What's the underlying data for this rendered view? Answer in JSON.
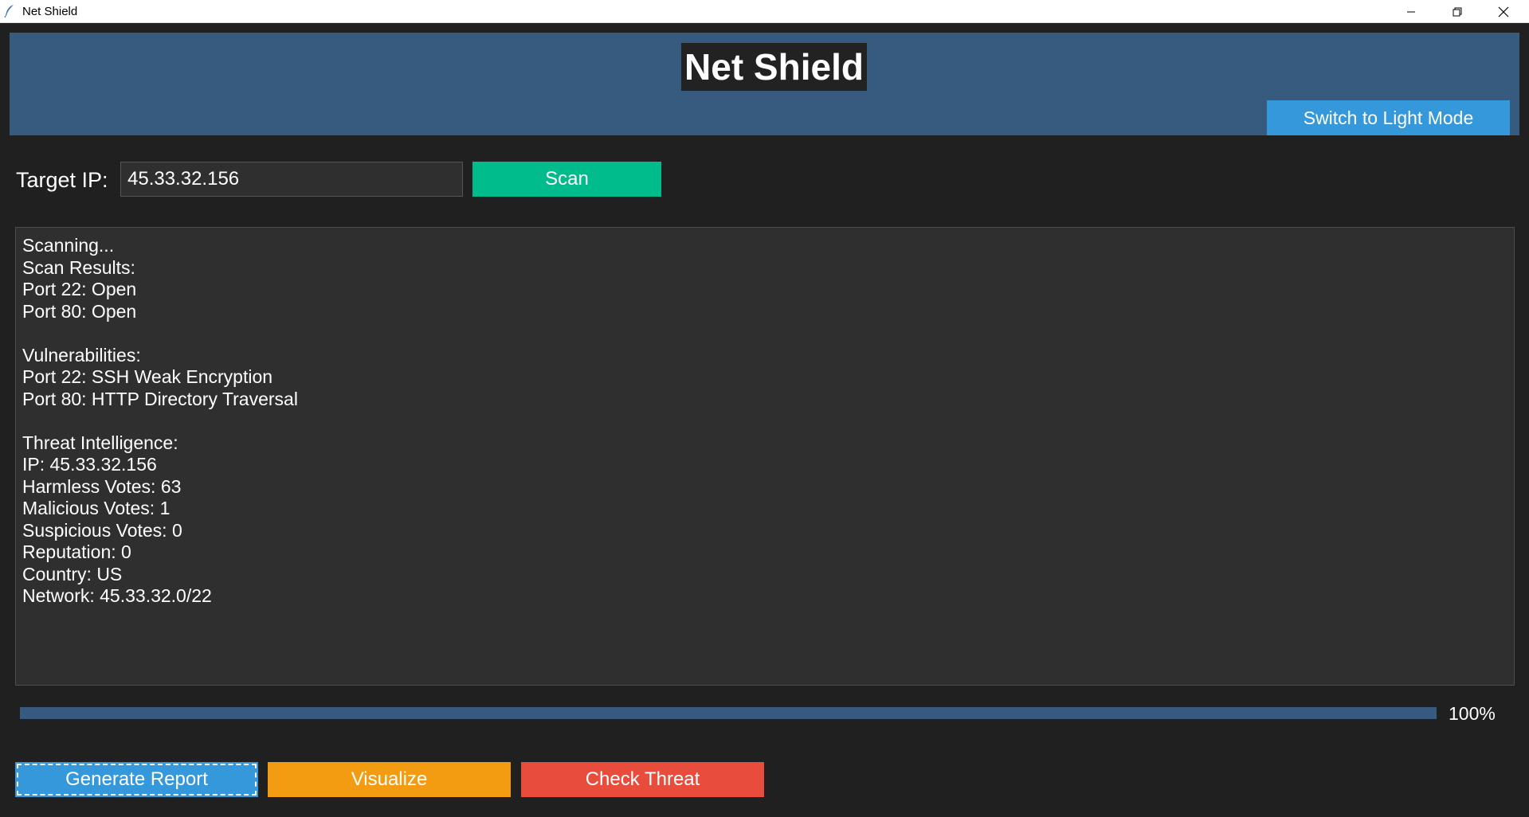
{
  "window": {
    "title": "Net Shield"
  },
  "header": {
    "title": "Net Shield",
    "mode_toggle_label": "Switch to Light Mode"
  },
  "scan_form": {
    "label": "Target IP:",
    "ip_value": "45.33.32.156",
    "scan_label": "Scan"
  },
  "output": {
    "lines": [
      "Scanning...",
      "Scan Results:",
      "Port 22: Open",
      "Port 80: Open",
      "",
      "Vulnerabilities:",
      "Port 22: SSH Weak Encryption",
      "Port 80: HTTP Directory Traversal",
      "",
      "Threat Intelligence:",
      "IP: 45.33.32.156",
      "Harmless Votes: 63",
      "Malicious Votes: 1",
      "Suspicious Votes: 0",
      "Reputation: 0",
      "Country: US",
      "Network: 45.33.32.0/22"
    ]
  },
  "progress": {
    "percent": 100,
    "label": "100%"
  },
  "actions": {
    "report_label": "Generate Report",
    "visualize_label": "Visualize",
    "threat_label": "Check Threat"
  },
  "colors": {
    "header_bg": "#375a7f",
    "scan": "#00bc8c",
    "report": "#3498db",
    "visualize": "#f39c12",
    "threat": "#e74c3c"
  },
  "icons": {
    "app": "feather-icon",
    "minimize": "minimize-icon",
    "maximize": "restore-icon",
    "close": "close-icon"
  }
}
